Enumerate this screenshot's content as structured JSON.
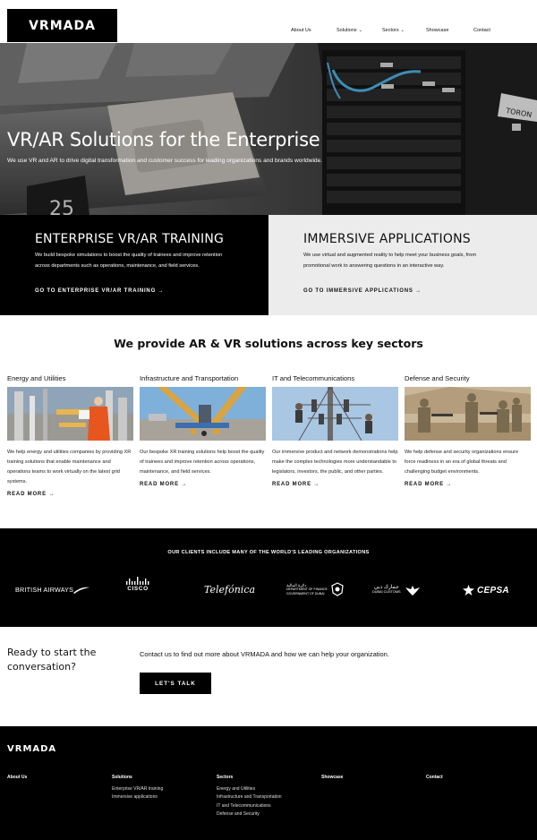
{
  "header": {
    "logo": "VRMADA",
    "nav": [
      {
        "label": "About Us"
      },
      {
        "label": "Solutions",
        "chevron": true
      },
      {
        "label": "Sectors",
        "chevron": true
      },
      {
        "label": "Showcase"
      },
      {
        "label": "Contact"
      }
    ]
  },
  "hero": {
    "title": "VR/AR Solutions for the Enterprise",
    "subtitle": "We use VR and AR to drive digital transformation and customer success for leading organizations and brands worldwide.",
    "image_label_number": "25",
    "image_sign": "TORON"
  },
  "panels": [
    {
      "title": "ENTERPRISE VR/AR TRAINING",
      "body": "We build bespoke simulations to boost the quality of trainees and improve retention across departments such as operations, maintenance, and field services.",
      "link": "GO TO ENTERPRISE VR/AR TRAINING →"
    },
    {
      "title": "IMMERSIVE APPLICATIONS",
      "body": "We use virtual and augmented reality to help meet your business goals, from promotional work to answering questions in an interactive way.",
      "link": "GO TO IMMERSIVE APPLICATIONS →"
    }
  ],
  "sectors": {
    "heading": "We provide AR & VR solutions across key sectors",
    "items": [
      {
        "title": "Energy and Utilities",
        "body": "We help energy and utilities companies by providing XR training solutions that enable maintenance and operations teams to work virtually on the latest grid systems.",
        "link": "READ MORE →"
      },
      {
        "title": "Infrastructure and Transportation",
        "body": "Our bespoke XR training solutions help boost the quality of trainees and improve retention across operations, maintenance, and field services.",
        "link": "READ MORE →"
      },
      {
        "title": "IT and Telecommunications",
        "body": "Our immersive product and network demonstrations help make the complex technologies more understandable to legislators, investors, the public, and other parties.",
        "link": "READ MORE →"
      },
      {
        "title": "Defense and Security",
        "body": "We help defense and security organizations ensure force readiness in an era of global threats and challenging budget environments.",
        "link": "READ MORE →"
      }
    ]
  },
  "clients": {
    "heading": "OUR CLIENTS INCLUDE MANY OF THE WORLD'S LEADING ORGANIZATIONS",
    "logos": [
      {
        "name": "BRITISH AIRWAYS"
      },
      {
        "name": "CISCO"
      },
      {
        "name": "Telefónica"
      },
      {
        "name": "DEPARTMENT OF FINANCE",
        "sub": "GOVERNMENT OF DUBAI",
        "arabic": "دائرة المالية"
      },
      {
        "name": "DUBAI CUSTOMS",
        "arabic": "جمارك دبي"
      },
      {
        "name": "CEPSA"
      }
    ]
  },
  "cta": {
    "question": "Ready to start the conversation?",
    "text": "Contact us to find out more about VRMADA and how we can help your organization.",
    "button": "LET'S TALK"
  },
  "footer": {
    "logo": "VRMADA",
    "columns": [
      {
        "heading": "About Us",
        "items": []
      },
      {
        "heading": "Solutions",
        "items": [
          "Enterprise VR/AR training",
          "Immersive applications"
        ]
      },
      {
        "heading": "Sectors",
        "items": [
          "Energy and Utilities",
          "Infrastructure and Transportation",
          "IT and Telecommunications",
          "Defense and Security"
        ]
      },
      {
        "heading": "Showcase",
        "items": []
      },
      {
        "heading": "Contact",
        "items": []
      }
    ]
  },
  "colors": {
    "black": "#000000",
    "light_panel": "#ececec",
    "accent_cable": "#4fb6e8"
  }
}
